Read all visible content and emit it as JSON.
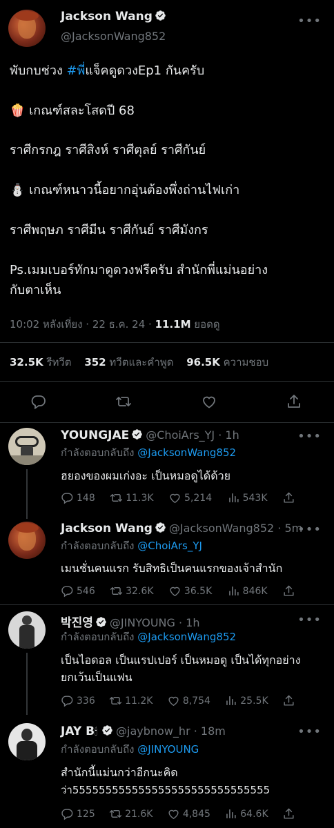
{
  "main_tweet": {
    "name": "Jackson Wang",
    "handle": "@JacksonWang852",
    "line1_prefix": "พับกบช่วง ",
    "line1_hashtag": "#พี่",
    "line1_suffix": "แจ็คดูดวงEp1 กันครับ",
    "line2_emoji": "🍿",
    "line2_text": " เกณฑ์สละโสดปี 68",
    "line3": "ราศีกรกฎ  ราศีสิงห์ ราศีตุลย์ ราศีกันย์",
    "line4_emoji": "⛄",
    "line4_text": " เกณฑ์หนาวนี้อยากอุ่นต้องพึ่งถ่านไฟเก่า",
    "line5": "ราศีพฤษภ ราศีมีน ราศีกันย์ ราศีมังกร",
    "line6": "Ps.เมมเบอร์ทักมาดูดวงฟรีครับ สำนักพี่แม่นอย่าง",
    "line7": "กับตาเห็น",
    "timestamp": "10:02 หลังเที่ยง · 22 ธ.ค. 24 · ",
    "views_count": "11.1M",
    "views_label": " ยอดดู",
    "retweets_count": "32.5K",
    "retweets_label": " รีทวีต",
    "quotes_count": "352",
    "quotes_label": " ทวีตและคำพูด",
    "likes_count": "96.5K",
    "likes_label": " ความชอบ"
  },
  "replies": [
    {
      "name": "YOUNGJAE",
      "handle": "@ChoiArs_YJ",
      "time": " · 1h",
      "replying_label": "กำลังตอบกลับถึง ",
      "replying_to": "@JacksonWang852",
      "text1": "ฮยองของผมเก่งอะ เป็นหมอดูได้ด้วย",
      "text2": "",
      "reply": "148",
      "retweet": "11.3K",
      "like": "5,214",
      "views": "543K"
    },
    {
      "name": "Jackson Wang",
      "handle": "@JacksonWang852",
      "time": " · 5m",
      "replying_label": "กำลังตอบกลับถึง ",
      "replying_to": "@ChoiArs_YJ",
      "text1": "เมนชั่นคนแรก รับสิทธิเป็นคนแรกของเจ้าสำนัก",
      "text2": "",
      "reply": "546",
      "retweet": "32.6K",
      "like": "36.5K",
      "views": "846K"
    },
    {
      "name": "박진영",
      "handle": "@JINYOUNG",
      "time": " · 1h",
      "replying_label": "กำลังตอบกลับถึง ",
      "replying_to": "@JacksonWang852",
      "text1": "เป็นไอดอล เป็นแรปเปอร์ เป็นหมอดู เป็นได้ทุกอย่าง",
      "text2": "ยกเว้นเป็นแฟน",
      "reply": "336",
      "retweet": "11.2K",
      "like": "8,754",
      "views": "25.5K"
    },
    {
      "name": "JAY B",
      "name_emoji": "🕯",
      "handle": "@jaybnow_hr",
      "time": " · 18m",
      "replying_label": "กำลังตอบกลับถึง ",
      "replying_to": "@JINYOUNG",
      "text1": "สำนักนี้แม่นกว่าอีกนะคิด",
      "text2": "ว่า555555555555555555555555555555",
      "reply": "125",
      "retweet": "21.6K",
      "like": "4,845",
      "views": "64.6K"
    }
  ],
  "icons": {
    "more": "more-dots-icon",
    "verified": "verified-badge-icon",
    "reply": "reply-icon",
    "retweet": "retweet-icon",
    "like": "like-icon",
    "views": "views-icon",
    "share": "share-icon"
  },
  "colors": {
    "background": "#000000",
    "text": "#e7e9ea",
    "muted": "#71767b",
    "accent": "#1d9bf0"
  },
  "more_glyph": "•••"
}
